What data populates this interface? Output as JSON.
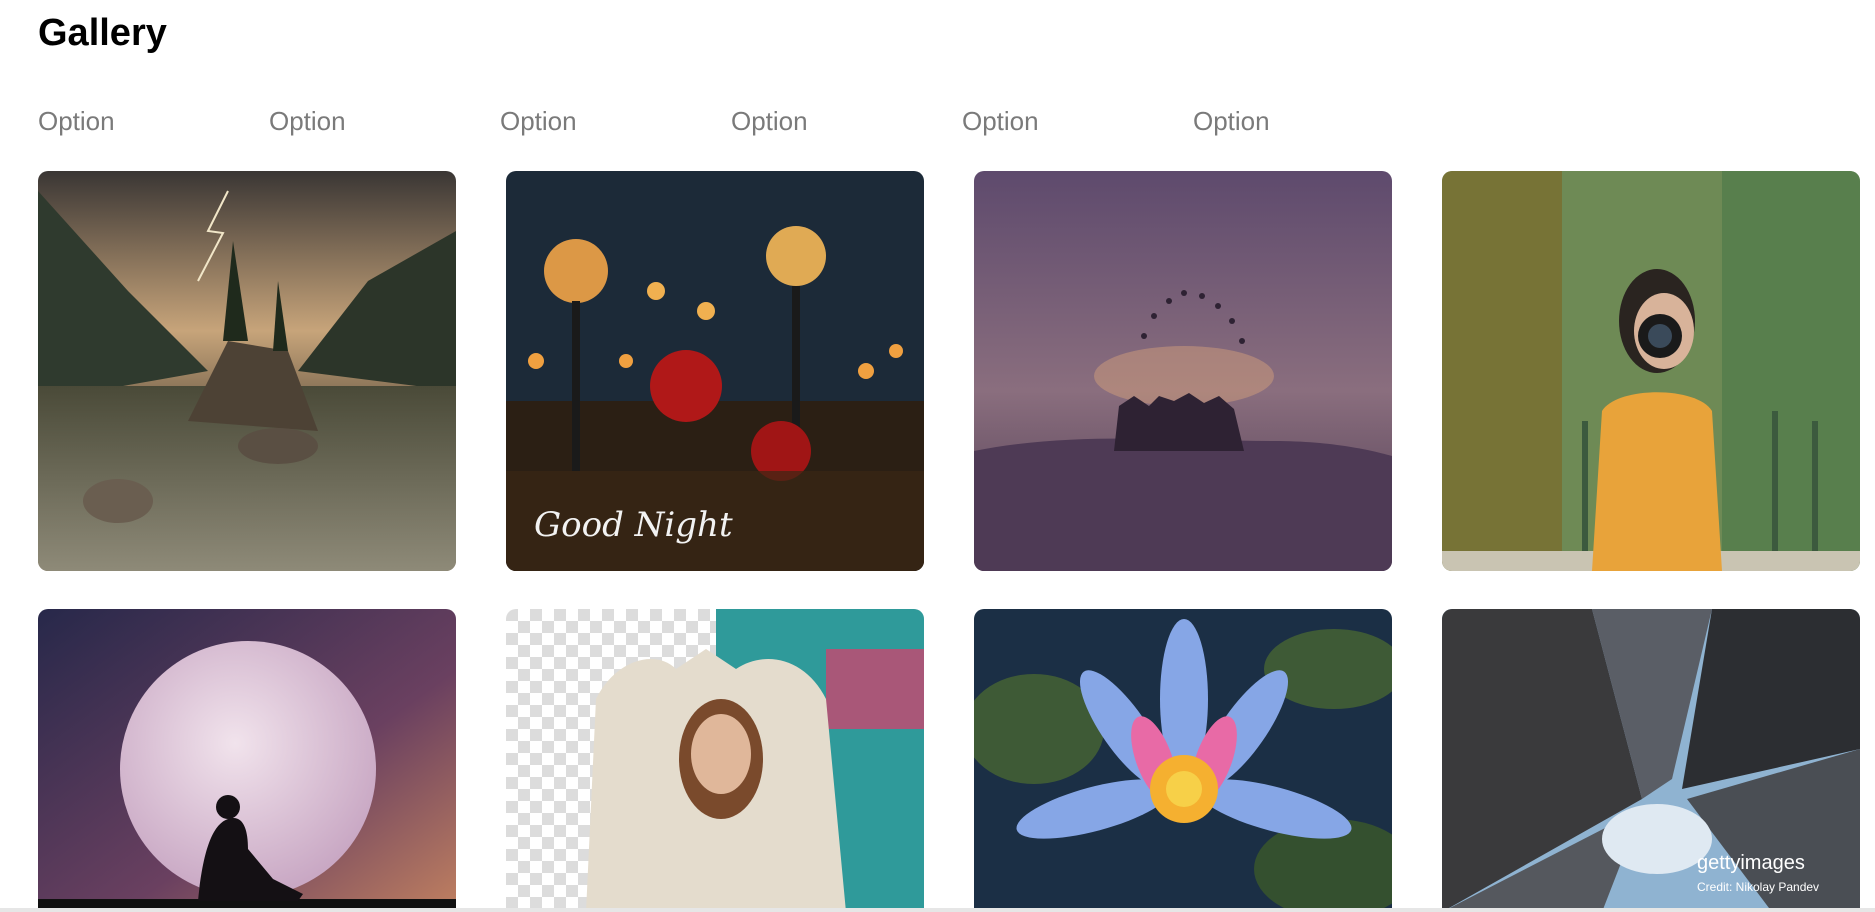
{
  "header": {
    "title": "Gallery"
  },
  "options": [
    "Option",
    "Option",
    "Option",
    "Option",
    "Option",
    "Option"
  ],
  "images": [
    {
      "subject": "mountain-lake-storm"
    },
    {
      "subject": "night-lamps-roses",
      "overlay_text": "Good Night"
    },
    {
      "subject": "graduation-silhouette-sunset"
    },
    {
      "subject": "woman-with-camera"
    },
    {
      "subject": "moon-silhouette"
    },
    {
      "subject": "woman-transparent-background"
    },
    {
      "subject": "water-lily"
    },
    {
      "subject": "skyscrapers-looking-up",
      "watermark": "gettyimages",
      "credit": "Credit: Nikolay Pandev"
    }
  ]
}
